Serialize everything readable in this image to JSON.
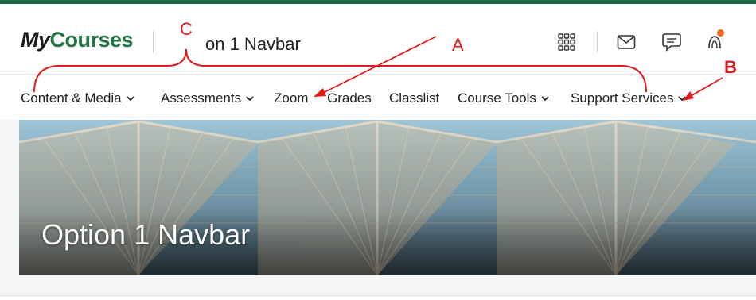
{
  "header": {
    "logo_my": "My",
    "logo_courses": "Courses",
    "course_title": "on 1 Navbar",
    "icons": [
      "waffle-grid-icon",
      "mail-icon",
      "chat-icon",
      "notification-icon"
    ]
  },
  "navbar": {
    "items": [
      {
        "label": "Content & Media",
        "has_dropdown": true
      },
      {
        "label": "Assessments",
        "has_dropdown": true
      },
      {
        "label": "Zoom",
        "has_dropdown": false
      },
      {
        "label": "Grades",
        "has_dropdown": false
      },
      {
        "label": "Classlist",
        "has_dropdown": false
      },
      {
        "label": "Course Tools",
        "has_dropdown": true
      },
      {
        "label": "Support Services",
        "has_dropdown": true
      }
    ]
  },
  "banner": {
    "title": "Option 1 Navbar"
  },
  "annotations": {
    "a": "A",
    "b": "B",
    "c": "C"
  },
  "colors": {
    "brand_green": "#207544",
    "accent_orange": "#f26a21",
    "annotation_red": "#e11b1b"
  }
}
